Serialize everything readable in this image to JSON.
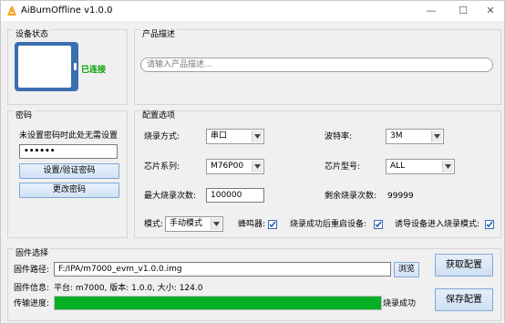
{
  "window": {
    "title": "AiBurnOffline v1.0.0",
    "controls": {
      "minimize": "—",
      "maximize": "☐",
      "close": "✕"
    }
  },
  "device_status": {
    "title": "设备状态",
    "device_icon": "tablet-icon",
    "status_text": "已连接",
    "status_color": "#00a000"
  },
  "product_description": {
    "title": "产品描述",
    "placeholder": "请输入产品描述..."
  },
  "password": {
    "title": "密码",
    "hint": "未设置密码时此处无需设置",
    "value": "••••••",
    "verify_button": "设置/验证密码",
    "change_button": "更改密码"
  },
  "config": {
    "title": "配置选项",
    "burn_mode_label": "烧录方式:",
    "burn_mode_value": "串口",
    "baud_label": "波特率:",
    "baud_value": "3M",
    "chip_series_label": "芯片系列:",
    "chip_series_value": "M76P00",
    "chip_model_label": "芯片型号:",
    "chip_model_value": "ALL",
    "max_burn_label": "最大烧录次数:",
    "max_burn_value": "100000",
    "remaining_label": "剩余烧录次数:",
    "remaining_value": "99999",
    "mode_label": "模式:",
    "mode_value": "手动模式",
    "buzzer_label": "蜂鸣器:",
    "buzzer_checked": true,
    "restart_label": "烧录成功后重启设备:",
    "restart_checked": true,
    "induce_label": "诱导设备进入烧录模式:",
    "induce_checked": true
  },
  "firmware": {
    "title": "固件选择",
    "path_label": "固件路径:",
    "path_value": "F:/IPA/m7000_evm_v1.0.0.img",
    "browse_button": "浏览",
    "info_label": "固件信息:",
    "info_value": "平台: m7000, 版本: 1.0.0, 大小: 124.0",
    "progress_label": "传输进度:",
    "progress_value": 1.0,
    "progress_color": "#06b025",
    "progress_status": "烧录成功"
  },
  "actions": {
    "get_config": "获取配置",
    "save_config": "保存配置"
  }
}
